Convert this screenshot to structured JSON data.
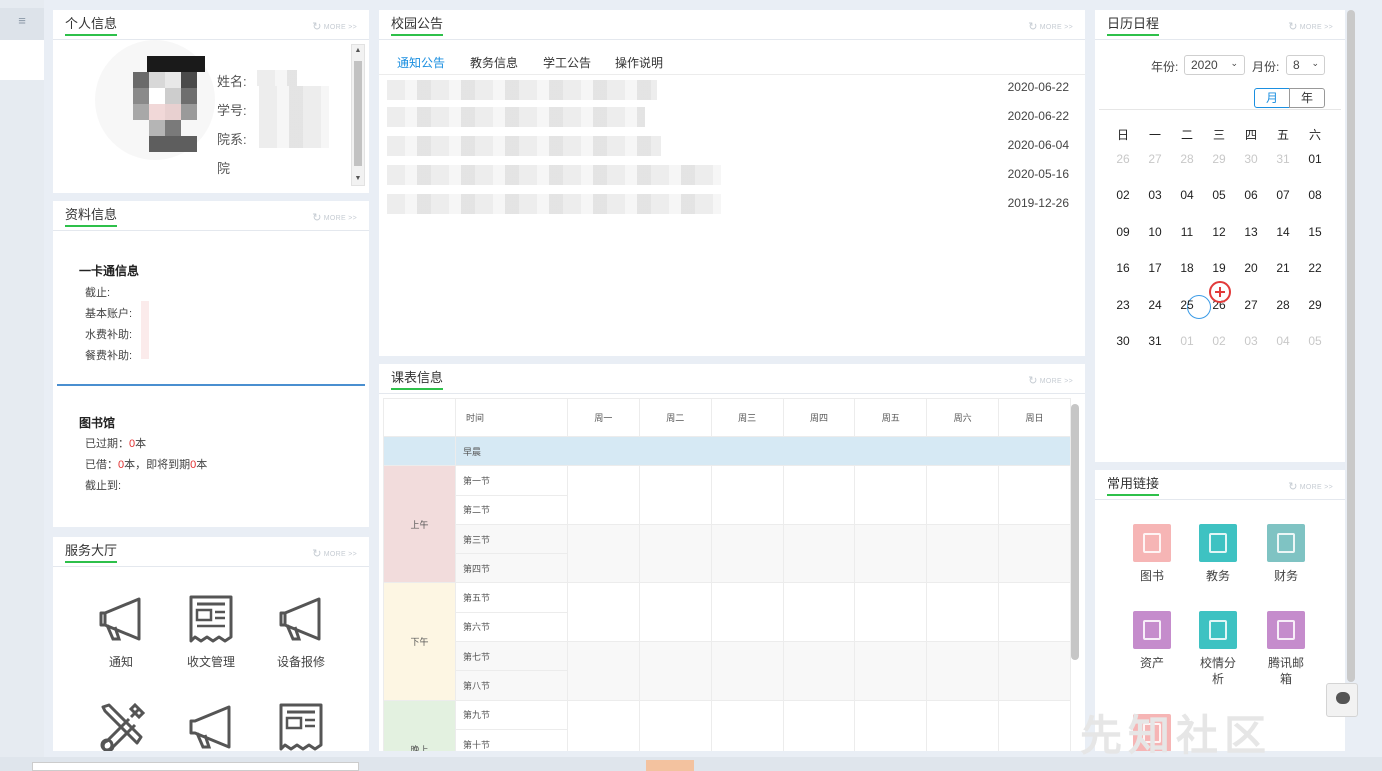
{
  "personal": {
    "title": "个人信息",
    "more": "MORE >>",
    "labels": [
      "姓名:",
      "学号:",
      "院系:",
      "院"
    ]
  },
  "profile": {
    "title": "资料信息",
    "more": "MORE >>",
    "card": {
      "title": "一卡通信息",
      "rows": [
        "截止:",
        "基本账户:",
        "水费补助:",
        "餐费补助:"
      ]
    },
    "library": {
      "title": "图书馆",
      "overdue_pre": "已过期：",
      "overdue_num": "0",
      "overdue_suf": "本",
      "borrowed_pre": "已借：",
      "borrowed_num": "0",
      "borrowed_mid": "本，即将到期",
      "due_num": "0",
      "due_suf": "本",
      "until": "截止到:"
    }
  },
  "services": {
    "title": "服务大厅",
    "more": "MORE >>",
    "items": [
      {
        "label": "通知",
        "icon": "megaphone-icon"
      },
      {
        "label": "收文管理",
        "icon": "newspaper-icon"
      },
      {
        "label": "设备报修",
        "icon": "megaphone-icon"
      },
      {
        "label": "",
        "icon": "tools-icon"
      },
      {
        "label": "",
        "icon": "megaphone-icon"
      },
      {
        "label": "",
        "icon": "newspaper-icon"
      }
    ]
  },
  "notice": {
    "title": "校园公告",
    "more": "MORE >>",
    "tabs": [
      "通知公告",
      "教务信息",
      "学工公告",
      "操作说明"
    ],
    "dates": [
      "2020-06-22",
      "2020-06-22",
      "2020-06-04",
      "2020-05-16",
      "2019-12-26"
    ]
  },
  "schedule": {
    "title": "课表信息",
    "more": "MORE >>",
    "header": [
      "时间",
      "周一",
      "周二",
      "周三",
      "周四",
      "周五",
      "周六",
      "周日"
    ],
    "morning_early": "早晨",
    "periods": [
      "上午",
      "下午",
      "晚上"
    ],
    "slots": [
      "第一节",
      "第二节",
      "第三节",
      "第四节",
      "第五节",
      "第六节",
      "第七节",
      "第八节",
      "第九节",
      "第十节"
    ]
  },
  "calendar": {
    "title": "日历日程",
    "more": "MORE >>",
    "year_label": "年份:",
    "year_value": "2020",
    "month_label": "月份:",
    "month_value": "8",
    "view_month": "月",
    "view_year": "年",
    "weekdays": [
      "日",
      "一",
      "二",
      "三",
      "四",
      "五",
      "六"
    ],
    "days": [
      "26",
      "27",
      "28",
      "29",
      "30",
      "31",
      "01",
      "02",
      "03",
      "04",
      "05",
      "06",
      "07",
      "08",
      "09",
      "10",
      "11",
      "12",
      "13",
      "14",
      "15",
      "16",
      "17",
      "18",
      "19",
      "20",
      "21",
      "22",
      "23",
      "24",
      "25",
      "26",
      "27",
      "28",
      "29",
      "30",
      "31",
      "01",
      "02",
      "03",
      "04",
      "05"
    ],
    "today": "25"
  },
  "links": {
    "title": "常用链接",
    "more": "MORE >>",
    "items": [
      {
        "label": "图书",
        "color": "#f6b5b5"
      },
      {
        "label": "教务",
        "color": "#3ec2c2"
      },
      {
        "label": "财务",
        "color": "#7fc3c3"
      },
      {
        "label": "资产",
        "color": "#c58ccc"
      },
      {
        "label": "校情分析",
        "color": "#3ec2c2"
      },
      {
        "label": "腾讯邮箱",
        "color": "#c58ccc"
      },
      {
        "label": "",
        "color": "#f6b5b5"
      }
    ]
  },
  "watermark": "先知社区"
}
